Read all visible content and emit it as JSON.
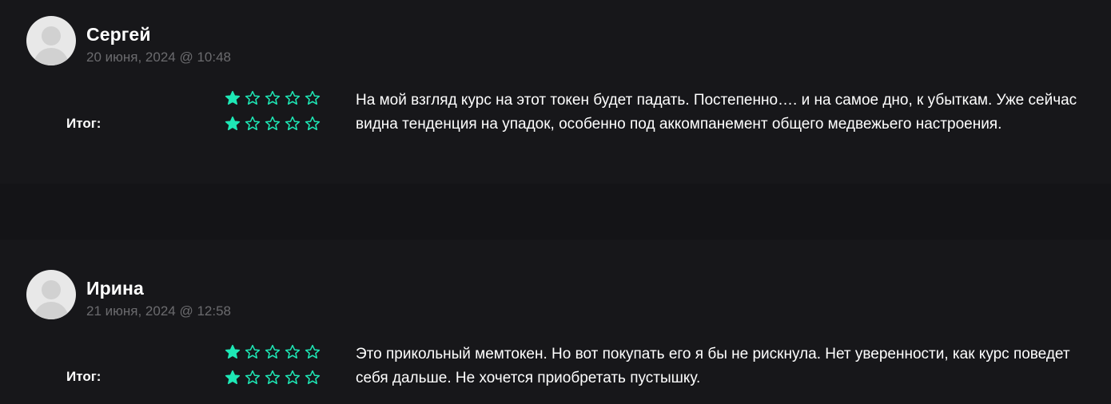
{
  "reviews": [
    {
      "author": "Сергей",
      "date": "20 июня, 2024 @ 10:48",
      "total_label": "Итог:",
      "rating_rows": [
        {
          "rating": 1,
          "max": 5
        },
        {
          "rating": 1,
          "max": 5
        }
      ],
      "text": "На мой взгляд курс на этот токен будет падать. Постепенно…. и на самое дно, к убыткам. Уже сейчас видна тенденция на упадок, особенно под аккомпанемент общего медвежьего настроения."
    },
    {
      "author": "Ирина",
      "date": "21 июня, 2024 @ 12:58",
      "total_label": "Итог:",
      "rating_rows": [
        {
          "rating": 1,
          "max": 5
        },
        {
          "rating": 1,
          "max": 5
        }
      ],
      "text": "Это прикольный мемтокен. Но вот покупать его я бы не рискнула. Нет уверенности, как курс поведет себя дальше. Не хочется приобретать пустышку."
    }
  ],
  "colors": {
    "background": "#17171a",
    "star_accent": "#1ee8b6",
    "date_text": "#6b6b6e"
  },
  "icons": {
    "avatar": "default-user-avatar-icon",
    "star_filled": "filled-star-icon",
    "star_empty": "empty-star-icon"
  }
}
